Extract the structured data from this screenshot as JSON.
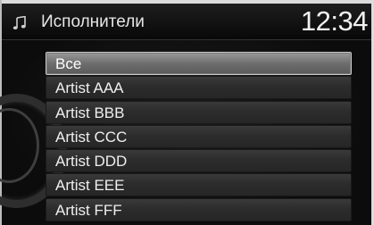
{
  "header": {
    "icon": "music-note-icon",
    "title": "Исполнители",
    "clock": "12:34"
  },
  "list": {
    "items": [
      {
        "label": "Все",
        "selected": true
      },
      {
        "label": "Artist AAA",
        "selected": false
      },
      {
        "label": "Artist BBB",
        "selected": false
      },
      {
        "label": "Artist CCC",
        "selected": false
      },
      {
        "label": "Artist DDD",
        "selected": false
      },
      {
        "label": "Artist EEE",
        "selected": false
      },
      {
        "label": "Artist FFF",
        "selected": false
      }
    ]
  },
  "colors": {
    "background": "#0f0f0f",
    "selected_row": "#7a7a7a",
    "row": "#2e2e2e",
    "text": "#efefef"
  }
}
